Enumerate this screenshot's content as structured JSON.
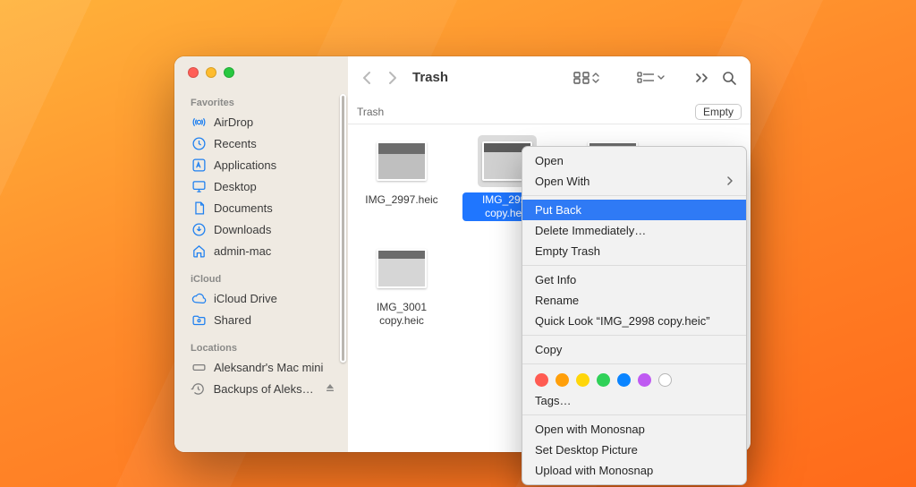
{
  "window": {
    "title": "Trash"
  },
  "sidebar": {
    "sections": [
      {
        "header": "Favorites",
        "items": [
          {
            "icon": "airdrop-icon",
            "label": "AirDrop"
          },
          {
            "icon": "recents-icon",
            "label": "Recents"
          },
          {
            "icon": "applications-icon",
            "label": "Applications"
          },
          {
            "icon": "desktop-icon",
            "label": "Desktop"
          },
          {
            "icon": "documents-icon",
            "label": "Documents"
          },
          {
            "icon": "downloads-icon",
            "label": "Downloads"
          },
          {
            "icon": "home-icon",
            "label": "admin-mac"
          }
        ]
      },
      {
        "header": "iCloud",
        "items": [
          {
            "icon": "icloud-drive-icon",
            "label": "iCloud Drive"
          },
          {
            "icon": "shared-icon",
            "label": "Shared"
          }
        ]
      },
      {
        "header": "Locations",
        "items": [
          {
            "icon": "mac-mini-icon",
            "label": "Aleksandr's Mac mini",
            "gray": true
          },
          {
            "icon": "timemachine-icon",
            "label": "Backups of Aleksa…",
            "gray": true,
            "eject": true
          }
        ]
      }
    ]
  },
  "pathbar": {
    "crumb": "Trash",
    "empty_label": "Empty"
  },
  "files": [
    {
      "name": "IMG_2997.heic",
      "thumb": "cat1",
      "selected": false
    },
    {
      "name": "IMG_2998 copy.heic",
      "thumb": "cat2",
      "selected": true
    },
    {
      "name": "",
      "thumb": "cat3",
      "selected": false,
      "name_hidden": true
    },
    {
      "name": "IMG_3001 copy.heic",
      "thumb": "cat4",
      "selected": false
    }
  ],
  "context_menu": {
    "groups": [
      [
        {
          "label": "Open"
        },
        {
          "label": "Open With",
          "submenu": true
        }
      ],
      [
        {
          "label": "Put Back",
          "hover": true
        },
        {
          "label": "Delete Immediately…"
        },
        {
          "label": "Empty Trash"
        }
      ],
      [
        {
          "label": "Get Info"
        },
        {
          "label": "Rename"
        },
        {
          "label": "Quick Look “IMG_2998 copy.heic”"
        }
      ],
      [
        {
          "label": "Copy"
        }
      ]
    ],
    "tag_colors": [
      "#ff5b52",
      "#ff9f0a",
      "#ffd60a",
      "#30d158",
      "#0a84ff",
      "#bf5af2"
    ],
    "tags_label": "Tags…",
    "extras": [
      {
        "label": "Open with Monosnap"
      },
      {
        "label": "Set Desktop Picture"
      },
      {
        "label": "Upload with Monosnap"
      }
    ]
  }
}
